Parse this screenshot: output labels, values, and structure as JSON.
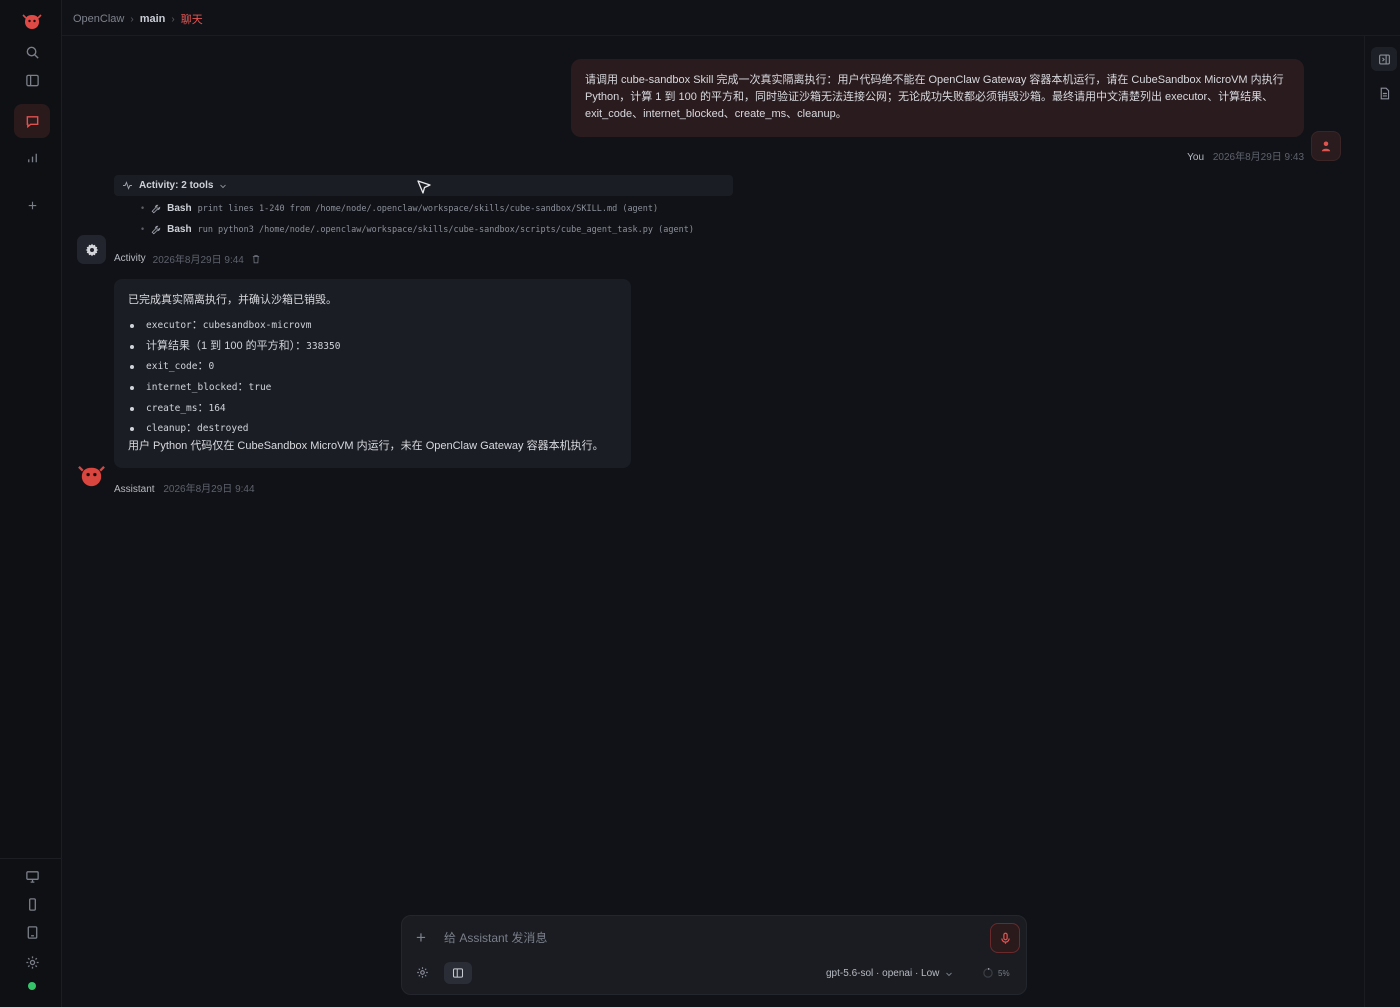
{
  "breadcrumb": {
    "root": "OpenClaw",
    "branch": "main",
    "current": "聊天"
  },
  "user_message": {
    "text": "请调用 cube-sandbox Skill 完成一次真实隔离执行：用户代码绝不能在 OpenClaw Gateway 容器本机运行，请在 CubeSandbox MicroVM 内执行 Python，计算 1 到 100 的平方和，同时验证沙箱无法连接公网；无论成功失败都必须销毁沙箱。最终请用中文清楚列出 executor、计算结果、exit_code、internet_blocked、create_ms、cleanup。",
    "sender": "You",
    "time": "2026年8月29日 9:43"
  },
  "activity": {
    "summary": "Activity: 2 tools",
    "tools": [
      {
        "name": "Bash",
        "detail": "print lines 1-240 from /home/node/.openclaw/workspace/skills/cube-sandbox/SKILL.md (agent)"
      },
      {
        "name": "Bash",
        "detail": "run python3 /home/node/.openclaw/workspace/skills/cube-sandbox/scripts/cube_agent_task.py (agent)"
      }
    ],
    "label": "Activity",
    "time": "2026年8月29日 9:44"
  },
  "assistant_message": {
    "intro": "已完成真实隔离执行，并确认沙箱已销毁。",
    "items": [
      {
        "key": "executor",
        "value": "cubesandbox-microvm",
        "cn": false
      },
      {
        "key": "计算结果（1 到 100 的平方和）",
        "value": "338350",
        "cn": true
      },
      {
        "key": "exit_code",
        "value": "0",
        "cn": false
      },
      {
        "key": "internet_blocked",
        "value": "true",
        "cn": false
      },
      {
        "key": "create_ms",
        "value": "164",
        "cn": false
      },
      {
        "key": "cleanup",
        "value": "destroyed",
        "cn": false
      }
    ],
    "outro": "用户 Python 代码仅在 CubeSandbox MicroVM 内运行，未在 OpenClaw Gateway 容器本机执行。",
    "sender": "Assistant",
    "time": "2026年8月29日 9:44"
  },
  "composer": {
    "placeholder": "给 Assistant 发消息",
    "model": "gpt-5.6-sol · openai · Low",
    "context_usage": "5%"
  },
  "colors": {
    "accent": "#e25553",
    "background": "#111217",
    "user_bubble": "#2a1c1e",
    "panel": "#1b1d24",
    "status_online": "#36c46a"
  },
  "icons": {
    "sidebar": [
      "logo-icon",
      "search-icon",
      "sidebar-toggle-icon",
      "chat-icon",
      "bar-chart-icon",
      "plus-icon",
      "monitor-icon",
      "phone-icon",
      "tablet-icon",
      "settings-icon"
    ],
    "right_rail": [
      "panel-icon",
      "document-icon"
    ]
  }
}
